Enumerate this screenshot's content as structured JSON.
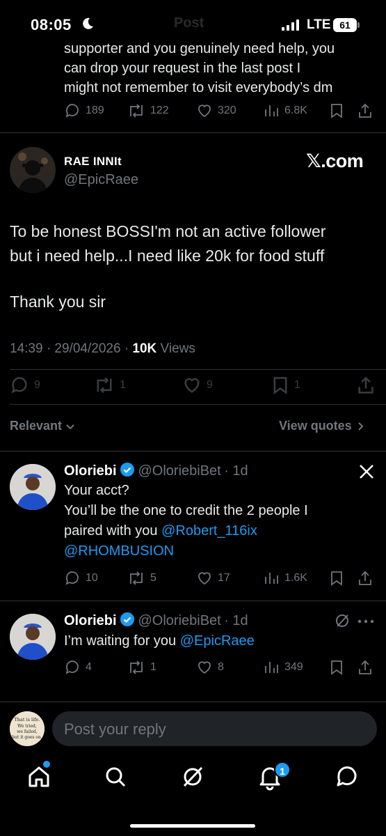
{
  "status_bar": {
    "time": "08:05",
    "network": "LTE",
    "battery": "61",
    "ghost_title": "Post"
  },
  "previous_tweet": {
    "text_lines": [
      "supporter and you genuinely need help, you",
      "can drop your request in the last post I",
      "might not remember to visit everybody’s dm"
    ],
    "replies": "189",
    "reposts": "122",
    "likes": "320",
    "views": "6.8K"
  },
  "main_tweet": {
    "author_name": "RAE INNIt",
    "handle": "@EpicRaee",
    "brand": "𝕏.com",
    "text_lines": [
      "To be honest BOSSI'm not an active follower",
      "but i need help...I need like 20k for food stuff"
    ],
    "text_line3": "Thank you sir",
    "timestamp": "14:39 · 29/04/2026 · ",
    "views_count": "10K",
    "views_label": " Views",
    "replies": "9",
    "reposts": "1",
    "likes": "9",
    "bookmarks": "1"
  },
  "sort": {
    "label": "Relevant",
    "quotes_label": "View quotes"
  },
  "replies": [
    {
      "name": "Oloriebi",
      "handle": "@OloriebiBet",
      "time": "· 1d",
      "text_line1": "Your acct?",
      "text_line2": "You’ll be the one to credit the 2 people I",
      "text_line3": "paired with you ",
      "mention1": "@Robert_116ix",
      "mention2": "@RHOMBUSION",
      "replies": "10",
      "reposts": "5",
      "likes": "17",
      "views": "1.6K"
    },
    {
      "name": "Oloriebi",
      "handle": "@OloriebiBet",
      "time": "· 1d",
      "text": "I’m waiting for you ",
      "mention": "@EpicRaee",
      "replies": "4",
      "reposts": "1",
      "likes": "8",
      "views": "349"
    }
  ],
  "composer": {
    "placeholder": "Post your reply",
    "avatar_text": "That is life. We tried, we failed, but it goes on."
  },
  "tab_bar": {
    "notifications_badge": "1"
  },
  "colors": {
    "accent": "#1d9bf0",
    "background": "#000000",
    "muted": "#71767b"
  }
}
